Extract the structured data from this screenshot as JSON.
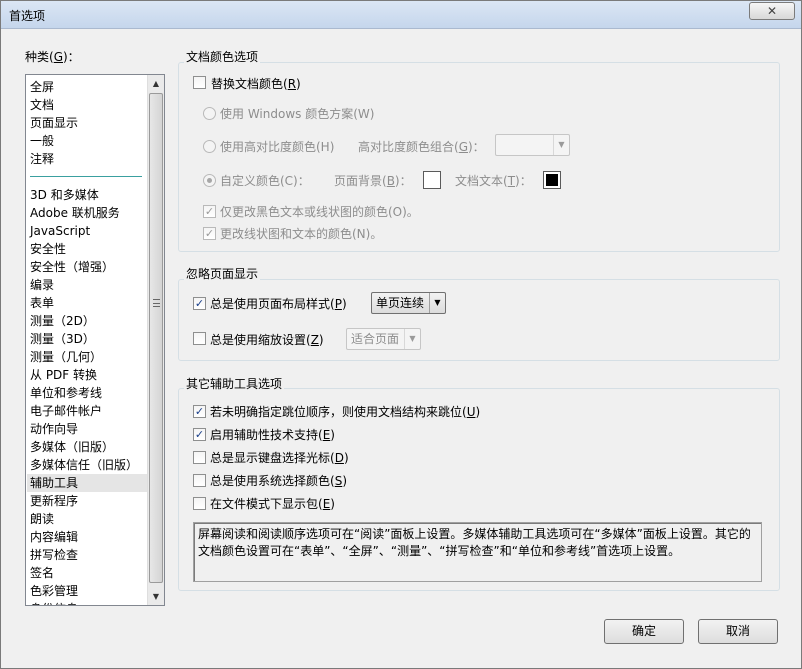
{
  "window": {
    "title": "首选项",
    "close_glyph": "✕"
  },
  "categories": {
    "label_prefix": "种类(",
    "label_key": "G",
    "label_suffix": ")：",
    "items": [
      "全屏",
      "文档",
      "页面显示",
      "一般",
      "注释",
      "3D 和多媒体",
      "Adobe 联机服务",
      "JavaScript",
      "安全性",
      "安全性（增强）",
      "编录",
      "表单",
      "测量（2D）",
      "测量（3D）",
      "测量（几何）",
      "从 PDF 转换",
      "单位和参考线",
      "电子邮件帐户",
      "动作向导",
      "多媒体（旧版）",
      "多媒体信任（旧版）",
      "辅助工具",
      "更新程序",
      "朗读",
      "内容编辑",
      "拼写检查",
      "签名",
      "色彩管理",
      "身份信息"
    ],
    "selected": "辅助工具"
  },
  "doc_colors": {
    "title": "文档颜色选项",
    "replace_colors": {
      "label": "替换文档颜色(",
      "key": "R",
      "suffix": ")",
      "checked": false
    },
    "windows_scheme": {
      "label": "使用 Windows 颜色方案(W)",
      "checked": false
    },
    "high_contrast": {
      "label": "使用高对比度颜色(H)",
      "checked": false
    },
    "high_contrast_combo_label": "高对比度颜色组合(",
    "high_contrast_combo_key": "G",
    "high_contrast_combo_suffix": ")：",
    "high_contrast_combo_value": "",
    "custom_color": {
      "label": "自定义颜色(C)：",
      "checked": true
    },
    "page_bg_label": "页面背景(",
    "page_bg_key": "B",
    "page_bg_suffix": ")：",
    "page_bg_color": "#ffffff",
    "doc_text_label": "文档文本(",
    "doc_text_key": "T",
    "doc_text_suffix": ")：",
    "doc_text_color": "#000000",
    "only_black_text": {
      "label": "仅更改黑色文本或线状图的颜色(O)。",
      "checked": true
    },
    "change_line_art": {
      "label": "更改线状图和文本的颜色(N)。",
      "checked": true
    }
  },
  "override_display": {
    "title": "忽略页面显示",
    "always_layout": {
      "label": "总是使用页面布局样式(",
      "key": "P",
      "suffix": ")",
      "checked": true
    },
    "layout_value": "单页连续",
    "always_zoom": {
      "label": "总是使用缩放设置(",
      "key": "Z",
      "suffix": ")",
      "checked": false
    },
    "zoom_value": "适合页面"
  },
  "other_options": {
    "title": "其它辅助工具选项",
    "items": [
      {
        "label": "若未明确指定跳位顺序，则使用文档结构来跳位(",
        "key": "U",
        "suffix": ")",
        "checked": true
      },
      {
        "label": "启用辅助性技术支持(",
        "key": "E",
        "suffix": ")",
        "checked": true
      },
      {
        "label": "总是显示键盘选择光标(",
        "key": "D",
        "suffix": ")",
        "checked": false
      },
      {
        "label": "总是使用系统选择颜色(",
        "key": "S",
        "suffix": ")",
        "checked": false
      },
      {
        "label": "在文件模式下显示包(",
        "key": "E",
        "suffix": ")",
        "checked": false
      }
    ],
    "description": "屏幕阅读和阅读顺序选项可在“阅读”面板上设置。多媒体辅助工具选项可在“多媒体”面板上设置。其它的文档颜色设置可在“表单”、“全屏”、“测量”、“拼写检查”和“单位和参考线”首选项上设置。"
  },
  "buttons": {
    "ok": "确定",
    "cancel": "取消"
  },
  "icons": {
    "check": "✓",
    "dropdown": "▼",
    "scroll_up": "▲",
    "scroll_down": "▼"
  }
}
